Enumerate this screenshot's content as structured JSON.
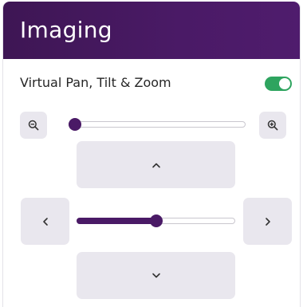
{
  "header": {
    "title": "Imaging"
  },
  "ptz": {
    "label": "Virtual Pan, Tilt & Zoom",
    "enabled": true
  },
  "zoom": {
    "value_fraction": 0.0
  },
  "pan": {
    "value_fraction": 0.5
  },
  "icons": {
    "zoom_out": "zoom-out-icon",
    "zoom_in": "zoom-in-icon",
    "up": "chevron-up-icon",
    "down": "chevron-down-icon",
    "left": "chevron-left-icon",
    "right": "chevron-right-icon"
  },
  "colors": {
    "header": "#4a1a66",
    "accent": "#4a1a66",
    "toggle_on": "#2ea45f",
    "button_bg": "#e9e7ee"
  }
}
